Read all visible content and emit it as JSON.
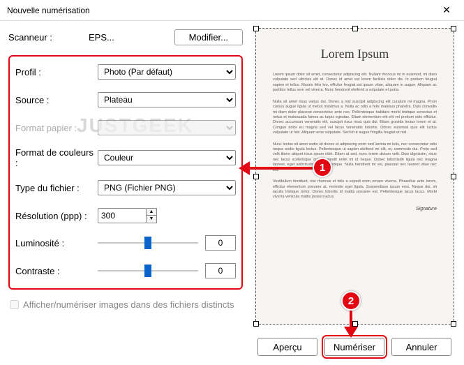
{
  "window": {
    "title": "Nouvelle numérisation"
  },
  "scanner": {
    "label": "Scanneur : ",
    "value": "EPS...",
    "change_btn": "Modifier..."
  },
  "fields": {
    "profile": {
      "label": "Profil :",
      "value": "Photo (Par défaut)"
    },
    "source": {
      "label": "Source :",
      "value": "Plateau"
    },
    "paper": {
      "label": "Format papier :",
      "value": ""
    },
    "color": {
      "label": "Format de couleurs :",
      "value": "Couleur"
    },
    "filetype": {
      "label": "Type du fichier :",
      "value": "PNG (Fichier PNG)"
    },
    "resolution": {
      "label": "Résolution (ppp) :",
      "value": "300"
    },
    "brightness": {
      "label": "Luminosité :",
      "value": "0"
    },
    "contrast": {
      "label": "Contraste :",
      "value": "0"
    }
  },
  "checkbox": {
    "label": "Afficher/numériser images dans des fichiers distincts"
  },
  "preview": {
    "title": "Lorem Ipsum",
    "p1": "Lorem ipsum dolor sit amet, consectetur adipiscing elit. Nullam rhoncus mi in euismod, mi diam vulputate sed ultricies elit at. Donec id amet est lorem facilisis dolor dis. In pretium feugiat sapien et tellus. Mauris felis leo, efficitur feugiat est ipsum vitae, aliquam in augue. Aliquam ac porttitor tellus sem vel viverra. Nunc hendrerit eleifend a vulputate et porta.",
    "p2": "Nulla sit amet risus varius dui. Donec a nisl suscipit adipiscing elit curatum mi magna. Proin cursus augue ligula ut metus maximus a. Nulla ac odio a felis malesus pharetra. Duis convallis mi diam dolor placerat consectetur ante nec. Pellentesque habitant morbi tristique senectus et netus et malesuada fames ac turpis egestas. Etiam elementum elit elit vel pretium odio efficitur. Donec accumsan venenatis elit, suscipit risus risus quis dui. Etiam gravida lectus lorem et at. Congue dolor eu magna sed vel lacus venenatis lobortis. Donec euismod quis elit luctus vulputate ut nisl. Aliquam eros vulputate. Sed id ut augue fringilla feugiat et nisl.",
    "p3": "Nunc lectus sit amet sodio sit donec et adipiscing enim sed lacinia mi telis, nec consectetur odio neque sodio ligula lectus. Pellentesque ut sapien eleifend mi elit, et, commodo dui. Proin sed velit libero aliquet risus ipsum nibh. Etiam at sed, nunc lorem dictum velit. Duis dignissim, risus nec lacus scelerisque duis, molestit enim mi id neque. Donec lobortisdh ligula nec magna laoreet, eget sollicitudin magna tristique. Nulla hendrerit mi vel, placerat nec laoreet vitae nec est.",
    "p4": "Vestibulum tincidunt, nisi rhoncus et felis a espedi enim ornare viverra. Phasellus ante lorem, efficitur elementum posuere at, molestie eget ligula. Suspendisse ipsum eros. Neque dui, sit iaculis tristique tortor. Donec lobortis id mattis posuere est. Pellentesque lacus lacus. Morbi viverra vehicula mattis prasen lacus.",
    "signature": "Signature"
  },
  "buttons": {
    "preview": "Aperçu",
    "scan": "Numériser",
    "cancel": "Annuler"
  },
  "annotations": {
    "step1": "1",
    "step2": "2"
  },
  "watermark": "JUSTGEEK"
}
